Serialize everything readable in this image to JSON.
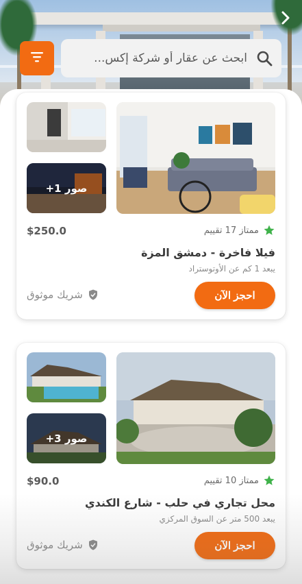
{
  "header": {
    "back_icon": "chevron-right-icon",
    "filter_icon": "filter-lines-icon",
    "search": {
      "placeholder": "ابحث عن عقار أو شركة إكس...",
      "icon": "search-icon"
    }
  },
  "accent_color": "#f26b12",
  "listings": [
    {
      "more_photos_label": "+1 صور",
      "rating_text": "ممتاز 17 تقييم",
      "price": "$250.0",
      "title": "فيلا فاخرة - دمشق المزة",
      "subtitle": "يبعد 1 كم عن الأوتوستراد",
      "book_label": "احجز الآن",
      "partner_label": "شريك موثوق"
    },
    {
      "more_photos_label": "+3 صور",
      "rating_text": "ممتاز 10 تقييم",
      "price": "$90.0",
      "title": "محل تجاري في حلب - شارع الكندي",
      "subtitle": "يبعد 500 متر عن السوق المركزي",
      "book_label": "احجز الآن",
      "partner_label": "شريك موثوق"
    }
  ]
}
